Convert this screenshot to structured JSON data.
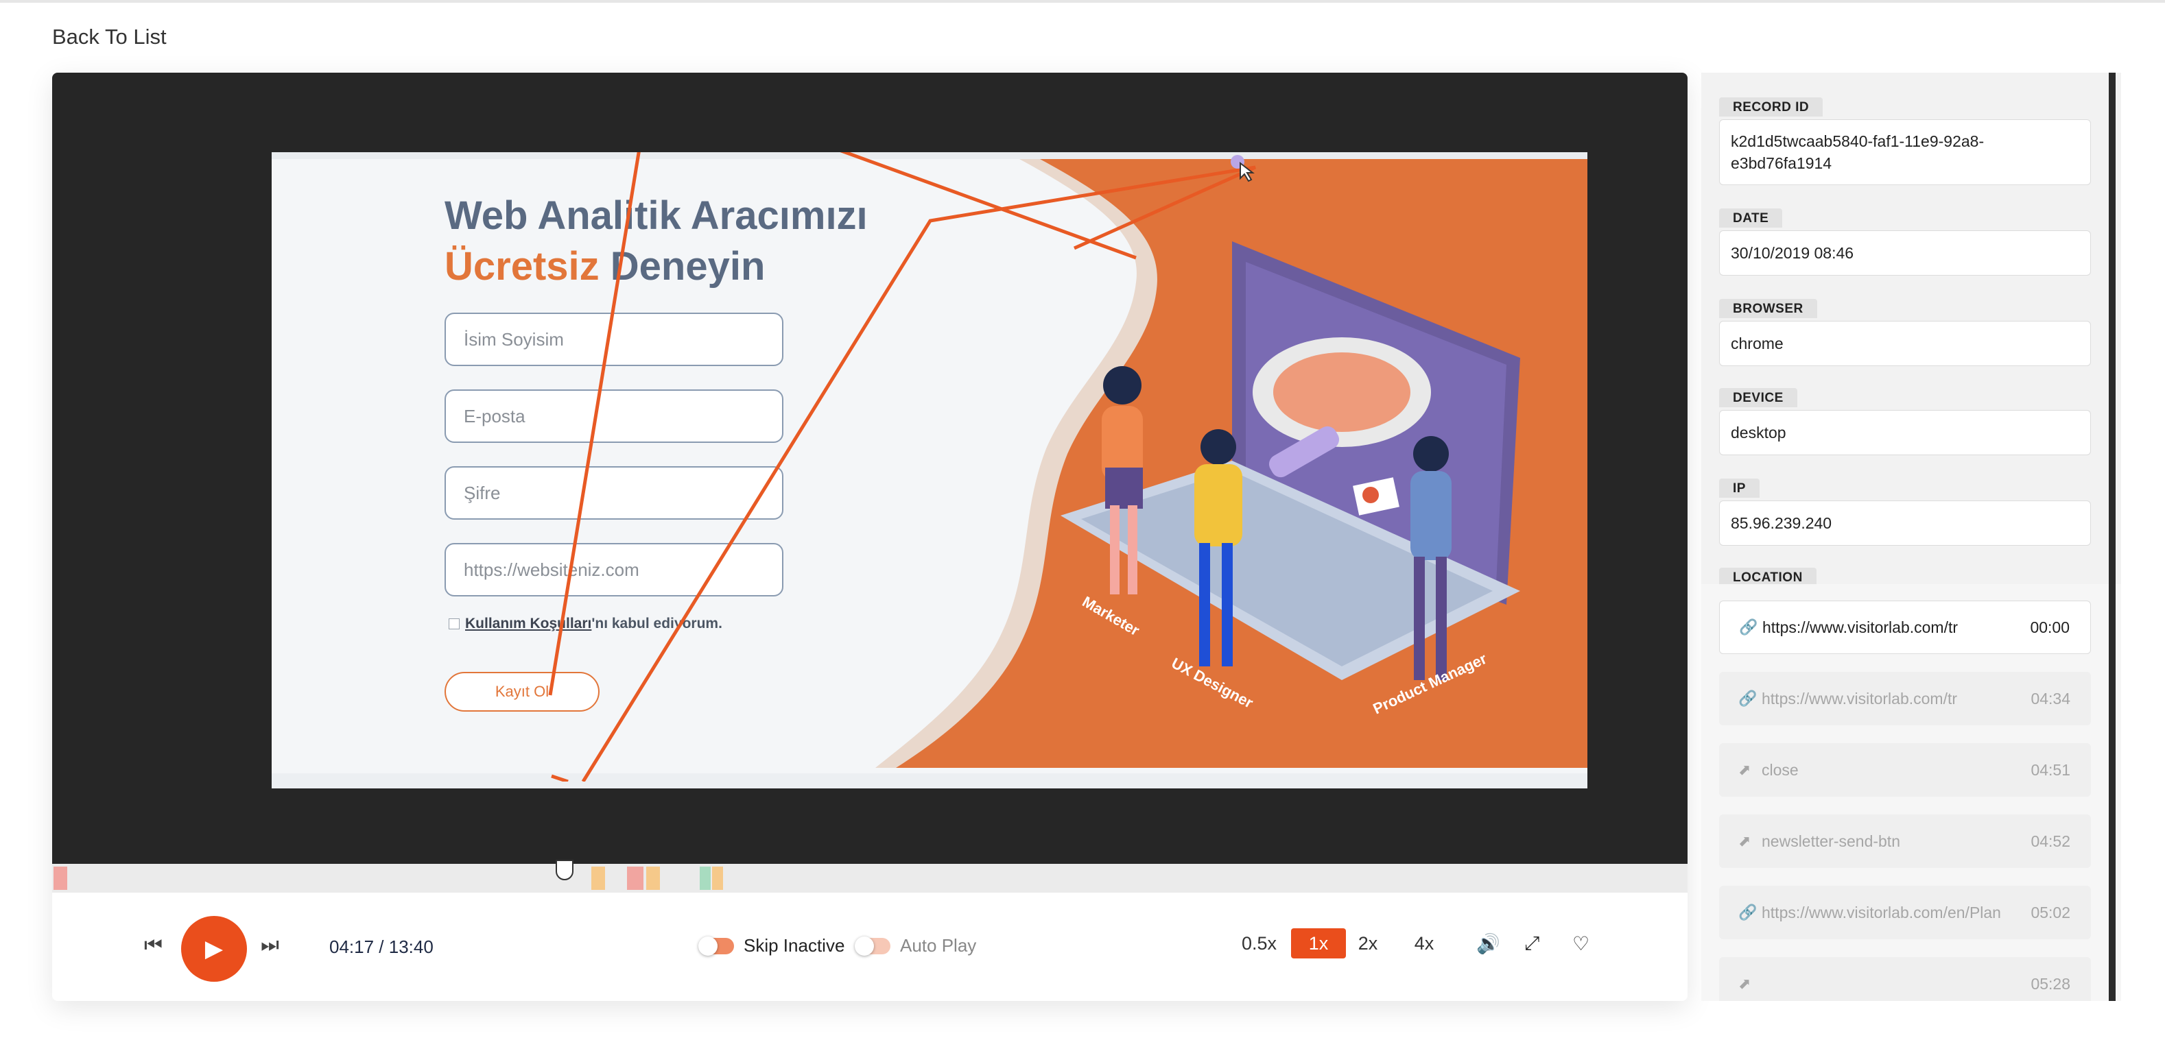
{
  "nav": {
    "back_label": "Back To List"
  },
  "recording": {
    "headline_line1": "Web Analitik Aracımızı",
    "headline_orange": "Ücretsiz",
    "headline_rest": " Deneyin",
    "fields": [
      {
        "placeholder": "İsim Soyisim"
      },
      {
        "placeholder": "E-posta"
      },
      {
        "placeholder": "Şifre"
      },
      {
        "placeholder": "https://websiteniz.com"
      }
    ],
    "terms_link": "Kullanım Koşulları",
    "terms_rest": "'nı kabul ediyorum.",
    "submit_label": "Kayıt Ol",
    "role_labels": [
      "Marketer",
      "UX Designer",
      "Product Manager"
    ]
  },
  "timeline": {
    "progress_fraction": 0.311,
    "markers": [
      {
        "color": "#f1a5a0"
      },
      {
        "color": "#f6c98a"
      },
      {
        "color": "#f1a5a0"
      },
      {
        "color": "#f6c98a"
      },
      {
        "color": "#a8dcc0"
      },
      {
        "color": "#f6c98a"
      }
    ]
  },
  "controls": {
    "time": "04:17 / 13:40",
    "skip_inactive_label": "Skip Inactive",
    "auto_play_label": "Auto Play",
    "speeds": [
      "0.5x",
      "1x",
      "2x",
      "4x"
    ],
    "active_speed": "1x",
    "icons": [
      "skip-back-icon",
      "play-icon",
      "skip-forward-icon",
      "volume-icon",
      "fullscreen-icon",
      "heart-icon"
    ],
    "accent_color": "#ea4e1c"
  },
  "details": {
    "record_id_label": "RECORD ID",
    "record_id": "k2d1d5twcaab5840-faf1-11e9-92a8-e3bd76fa1914",
    "date_label": "DATE",
    "date": "30/10/2019 08:46",
    "browser_label": "BROWSER",
    "browser": "chrome",
    "device_label": "DEVICE",
    "device": "desktop",
    "ip_label": "IP",
    "ip": "85.96.239.240",
    "location_label": "LOCATION"
  },
  "events": [
    {
      "type": "link-icon",
      "label": "https://www.visitorlab.com/tr",
      "time": "00:00",
      "state": "current"
    },
    {
      "type": "link-icon",
      "label": "https://www.visitorlab.com/tr",
      "time": "04:34",
      "state": "upcoming"
    },
    {
      "type": "cursor-icon",
      "label": "close",
      "time": "04:51",
      "state": "upcoming"
    },
    {
      "type": "cursor-icon",
      "label": "newsletter-send-btn",
      "time": "04:52",
      "state": "upcoming"
    },
    {
      "type": "link-icon",
      "label": "https://www.visitorlab.com/en/Plan",
      "time": "05:02",
      "state": "upcoming"
    },
    {
      "type": "cursor-icon",
      "label": "",
      "time": "05:28",
      "state": "upcoming"
    }
  ]
}
